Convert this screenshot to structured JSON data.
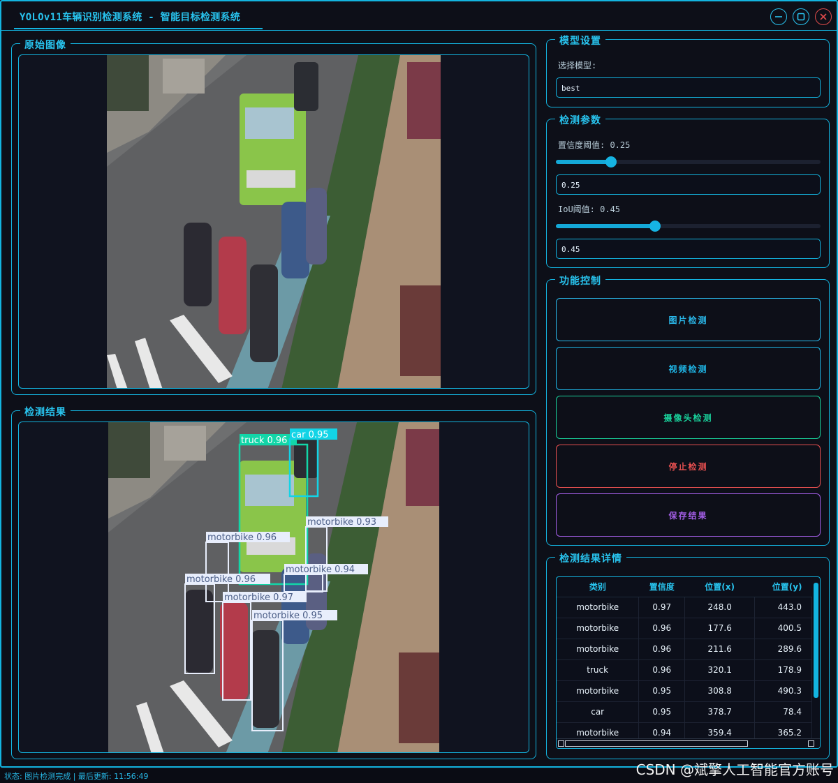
{
  "window": {
    "title": "YOLOv11车辆识别检测系统 - 智能目标检测系统"
  },
  "panels": {
    "original": {
      "title": "原始图像"
    },
    "result": {
      "title": "检测结果"
    },
    "model": {
      "title": "模型设置",
      "select_label": "选择模型:",
      "selected_model": "best"
    },
    "params": {
      "title": "检测参数",
      "conf_label": "置信度阈值: 0.25",
      "conf_value": "0.25",
      "conf_level": 0.25,
      "iou_label": "IoU阈值: 0.45",
      "iou_value": "0.45",
      "iou_level": 0.45
    },
    "controls": {
      "title": "功能控制",
      "image_btn": "图片检测",
      "video_btn": "视频检测",
      "camera_btn": "摄像头检测",
      "stop_btn": "停止检测",
      "save_btn": "保存结果"
    },
    "details": {
      "title": "检测结果详情",
      "columns": [
        "类别",
        "置信度",
        "位置(x)",
        "位置(y)"
      ],
      "rows": [
        [
          "motorbike",
          "0.97",
          "248.0",
          "443.0"
        ],
        [
          "motorbike",
          "0.96",
          "177.6",
          "400.5"
        ],
        [
          "motorbike",
          "0.96",
          "211.6",
          "289.6"
        ],
        [
          "truck",
          "0.96",
          "320.1",
          "178.9"
        ],
        [
          "motorbike",
          "0.95",
          "308.8",
          "490.3"
        ],
        [
          "car",
          "0.95",
          "378.7",
          "78.4"
        ],
        [
          "motorbike",
          "0.94",
          "359.4",
          "365.2"
        ]
      ]
    }
  },
  "detections": [
    {
      "label": "truck 0.96"
    },
    {
      "label": "car 0.95"
    },
    {
      "label": "motorbike 0.93"
    },
    {
      "label": "motorbike 0.96"
    },
    {
      "label": "motorbike 0.94"
    },
    {
      "label": "motorbike 0.96"
    },
    {
      "label": "motorbike 0.97"
    },
    {
      "label": "motorbike 0.95"
    }
  ],
  "colors": {
    "accent": "#13b4e0",
    "image_btn": "#2ab8ea",
    "video_btn": "#1fb6e6",
    "camera_btn": "#19d19b",
    "stop_btn": "#e85050",
    "save_btn": "#a35ee6"
  },
  "status": {
    "text": "状态: 图片检测完成 | 最后更新: 11:56:49"
  },
  "watermark": "CSDN @斌擎人工智能官方账号"
}
